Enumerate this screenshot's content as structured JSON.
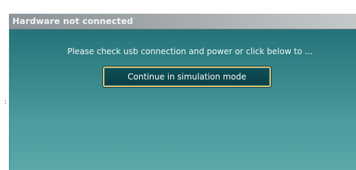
{
  "dialog": {
    "title": "Hardware not connected",
    "message": "Please check usb connection and power or click below to ...",
    "simulation_button_label": "Continue in simulation mode"
  },
  "side_glyph": ":",
  "colors": {
    "title_text": "#f2f4f5",
    "dialog_top": "#1f6b72",
    "dialog_bottom": "#5aa8a8",
    "button_bg": "#0f4f57",
    "button_border": "#e0c77a"
  }
}
